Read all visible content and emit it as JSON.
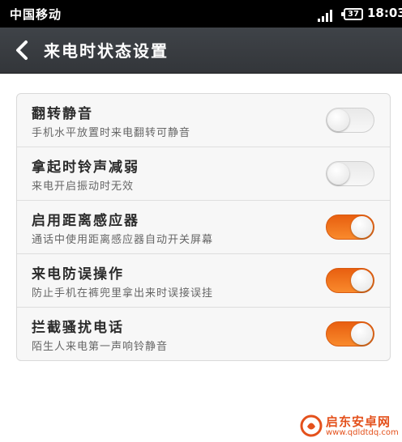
{
  "status_bar": {
    "carrier": "中国移动",
    "battery": "37",
    "time": "18:03",
    "icons": [
      "signal-icon",
      "battery-icon"
    ]
  },
  "header": {
    "title": "来电时状态设置",
    "back_icon": "back-arrow-icon"
  },
  "settings": [
    {
      "title": "翻转静音",
      "description": "手机水平放置时来电翻转可静音",
      "enabled": false
    },
    {
      "title": "拿起时铃声减弱",
      "description": "来电开启振动时无效",
      "enabled": false
    },
    {
      "title": "启用距离感应器",
      "description": "通话中使用距离感应器自动开关屏幕",
      "enabled": true
    },
    {
      "title": "来电防误操作",
      "description": "防止手机在裤兜里拿出来时误接误挂",
      "enabled": true
    },
    {
      "title": "拦截骚扰电话",
      "description": "陌生人来电第一声响铃静音",
      "enabled": true
    }
  ],
  "watermark": {
    "name": "启东安卓网",
    "url": "www.qdldtdq.com"
  },
  "colors": {
    "toggle_on": "#f27a22",
    "toggle_off": "#eeeeee",
    "title_bar": "#3a3d41",
    "status_bar": "#000000"
  }
}
